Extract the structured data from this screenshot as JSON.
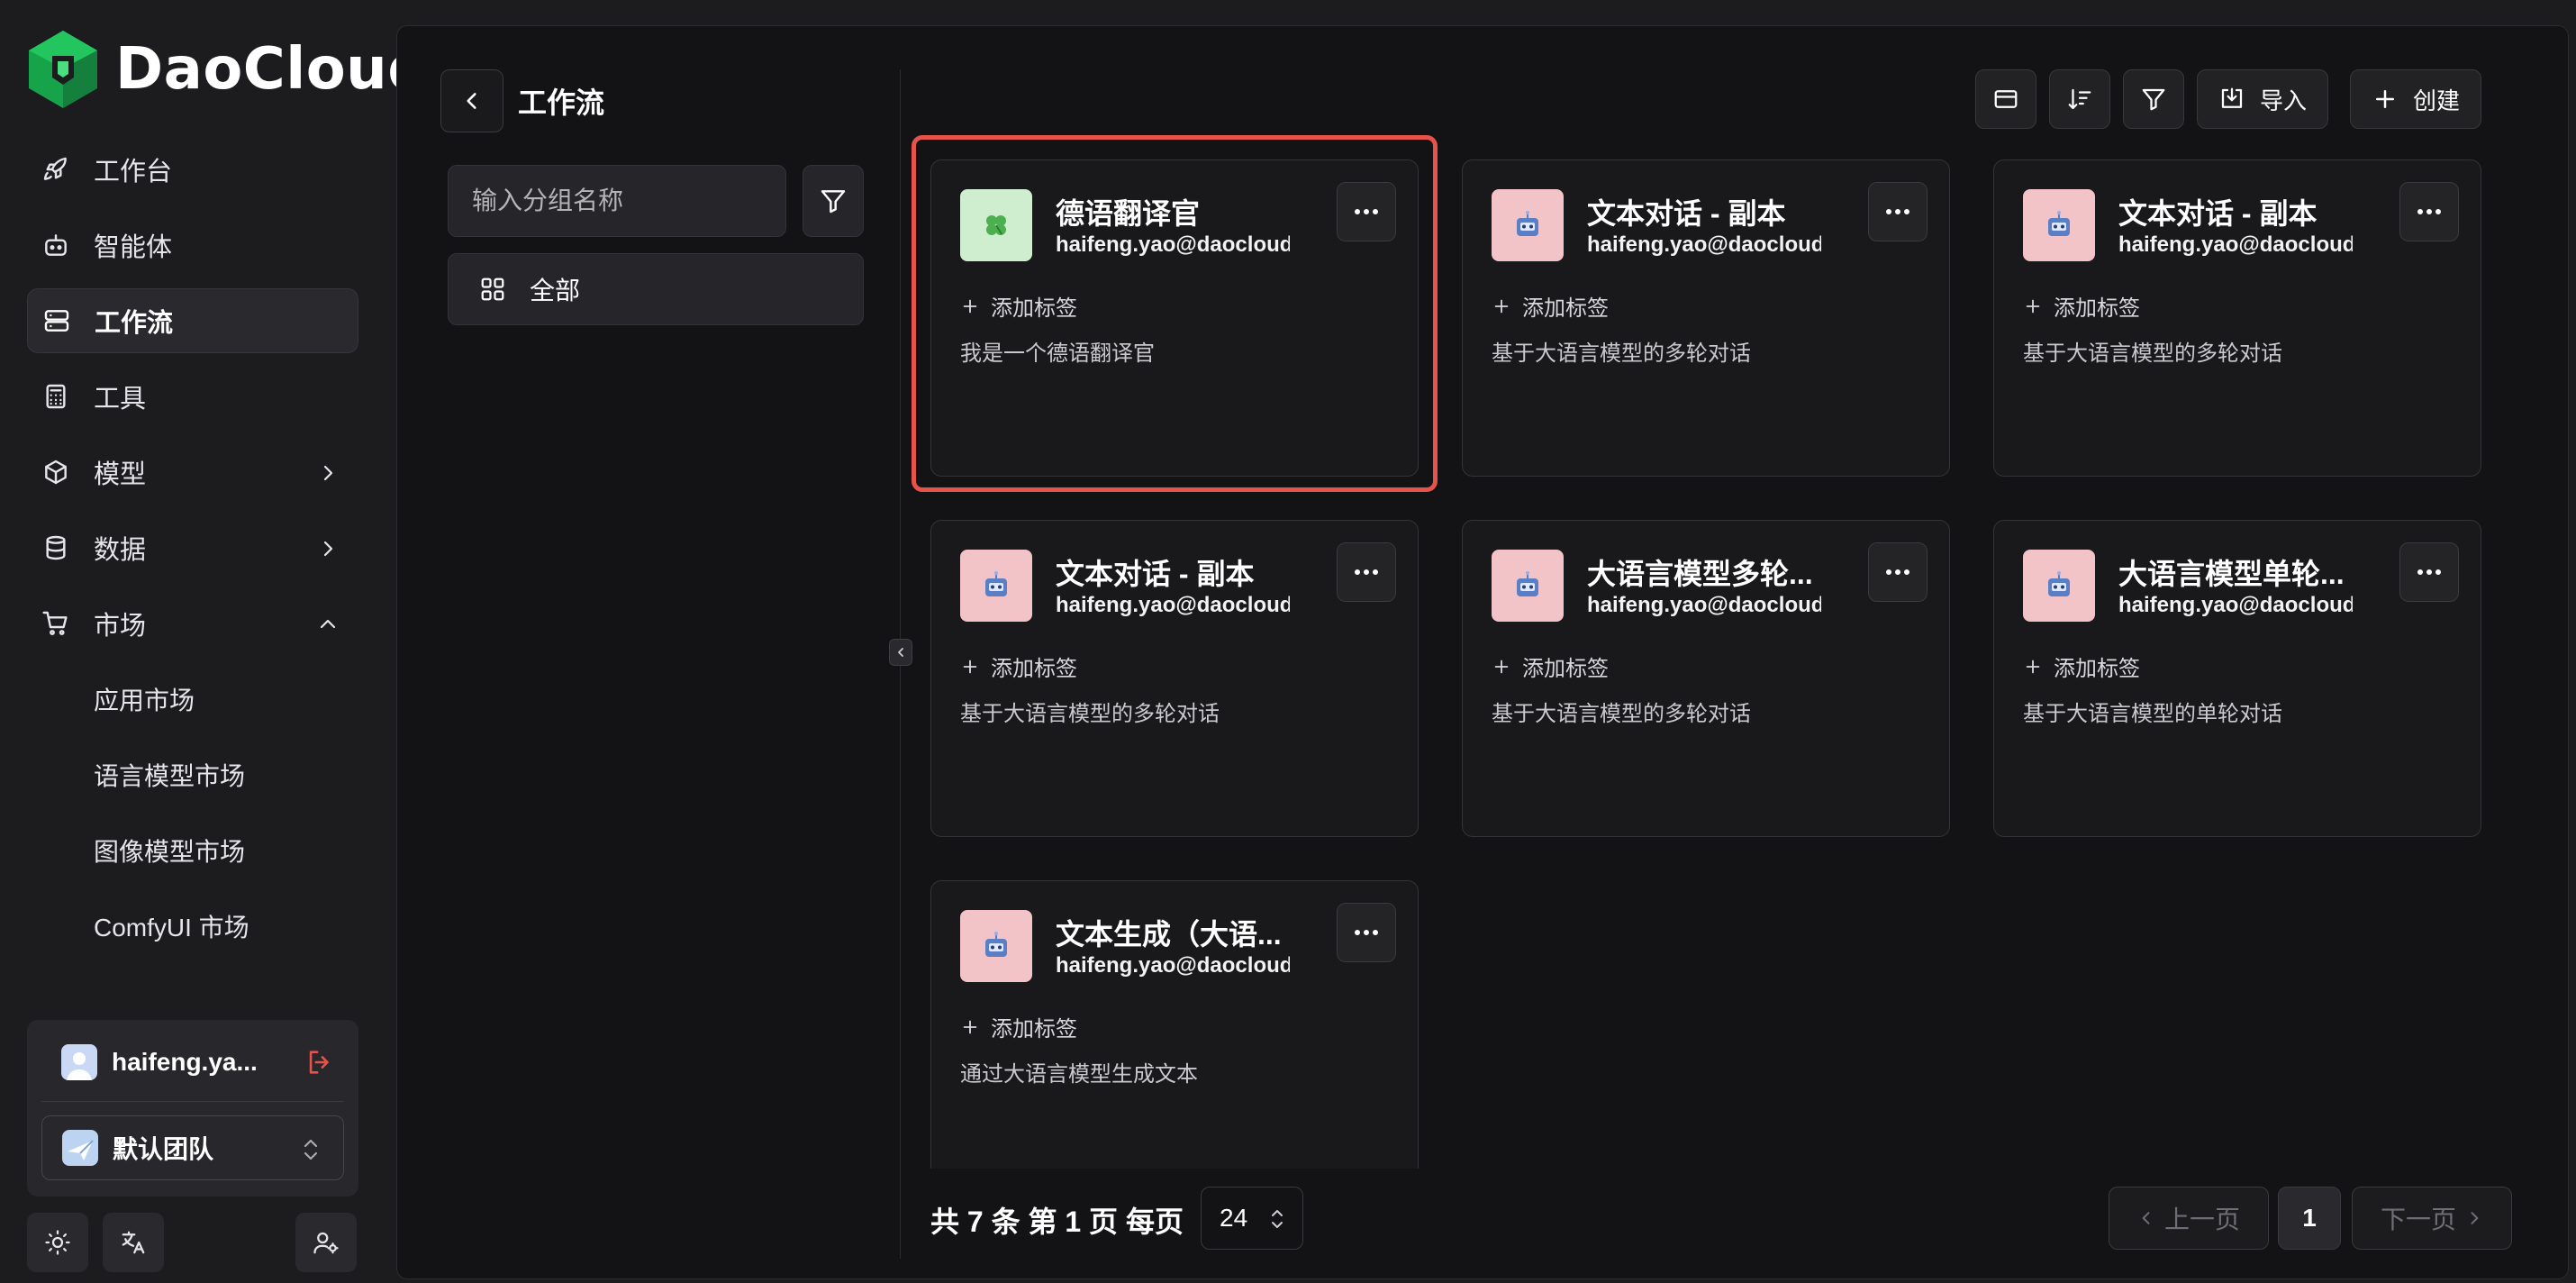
{
  "brand": {
    "name": "DaoCloud",
    "color": "#22c55e"
  },
  "nav": {
    "items": [
      {
        "label": "工作台",
        "icon": "rocket-icon"
      },
      {
        "label": "智能体",
        "icon": "robot-icon"
      },
      {
        "label": "工作流",
        "icon": "workflow-icon",
        "active": true
      },
      {
        "label": "工具",
        "icon": "calculator-icon"
      },
      {
        "label": "模型",
        "icon": "cube-icon",
        "expandable": true
      },
      {
        "label": "数据",
        "icon": "database-icon",
        "expandable": true
      },
      {
        "label": "市场",
        "icon": "cart-icon",
        "expanded": true
      }
    ],
    "market_sub": [
      "应用市场",
      "语言模型市场",
      "图像模型市场",
      "ComfyUI 市场"
    ]
  },
  "user": {
    "name": "haifeng.ya...",
    "team": "默认团队"
  },
  "page": {
    "title": "工作流"
  },
  "groups": {
    "search_placeholder": "输入分组名称",
    "all_label": "全部"
  },
  "toolbar": {
    "import_label": "导入",
    "create_label": "创建"
  },
  "cards": [
    {
      "title": "德语翻译官",
      "email": "haifeng.yao@daocloud.io",
      "tag_label": "添加标签",
      "desc": "我是一个德语翻译官",
      "icon": "clover-icon",
      "selected": true
    },
    {
      "title": "文本对话 - 副本",
      "email": "haifeng.yao@daocloud.io",
      "tag_label": "添加标签",
      "desc": "基于大语言模型的多轮对话",
      "icon": "robot-icon"
    },
    {
      "title": "文本对话 - 副本",
      "email": "haifeng.yao@daocloud.io",
      "tag_label": "添加标签",
      "desc": "基于大语言模型的多轮对话",
      "icon": "robot-icon"
    },
    {
      "title": "文本对话 - 副本",
      "email": "haifeng.yao@daocloud.io",
      "tag_label": "添加标签",
      "desc": "基于大语言模型的多轮对话",
      "icon": "robot-icon"
    },
    {
      "title": "大语言模型多轮...",
      "email": "haifeng.yao@daocloud.io",
      "tag_label": "添加标签",
      "desc": "基于大语言模型的多轮对话",
      "icon": "robot-icon"
    },
    {
      "title": "大语言模型单轮...",
      "email": "haifeng.yao@daocloud.io",
      "tag_label": "添加标签",
      "desc": "基于大语言模型的单轮对话",
      "icon": "robot-icon"
    },
    {
      "title": "文本生成（大语...",
      "email": "haifeng.yao@daocloud.io",
      "tag_label": "添加标签",
      "desc": "通过大语言模型生成文本",
      "icon": "robot-icon"
    }
  ],
  "pagination": {
    "summary": "共 7 条 第 1 页  每页",
    "page_size": "24",
    "prev_label": "上一页",
    "current_page": "1",
    "next_label": "下一页"
  },
  "colors": {
    "accent_red": "#e5534b",
    "panel": "#131315",
    "sidebar": "#1c1c1f"
  }
}
